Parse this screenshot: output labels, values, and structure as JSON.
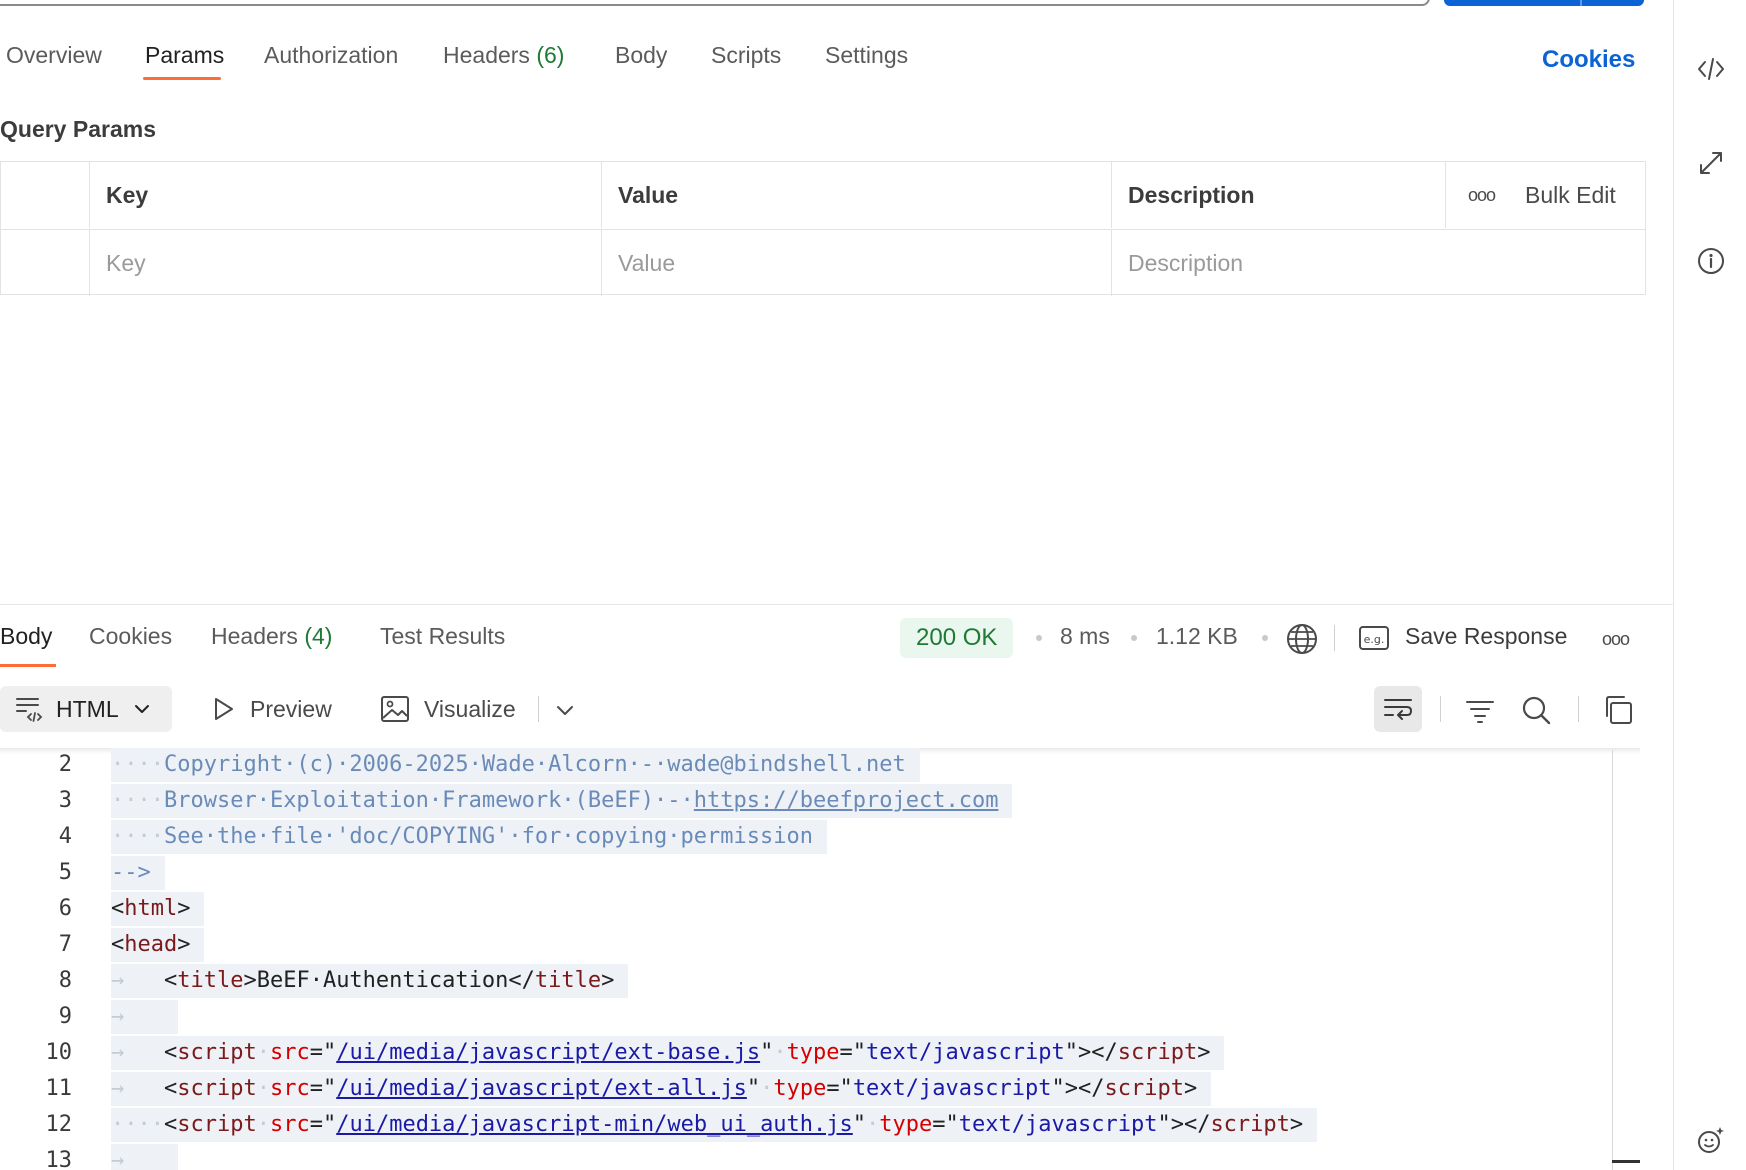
{
  "request_tabs": [
    {
      "label": "Overview"
    },
    {
      "label": "Params"
    },
    {
      "label": "Authorization"
    },
    {
      "label": "Headers",
      "count": "(6)"
    },
    {
      "label": "Body"
    },
    {
      "label": "Scripts"
    },
    {
      "label": "Settings"
    }
  ],
  "cookies_link": "Cookies",
  "query_params": {
    "title": "Query Params",
    "columns": [
      "Key",
      "Value",
      "Description"
    ],
    "bulk_edit": "Bulk Edit",
    "more": "ooo",
    "placeholders": {
      "key": "Key",
      "value": "Value",
      "description": "Description"
    }
  },
  "response": {
    "tabs": [
      {
        "label": "Body"
      },
      {
        "label": "Cookies"
      },
      {
        "label": "Headers",
        "count": "(4)"
      },
      {
        "label": "Test Results"
      }
    ],
    "status": "200 OK",
    "time": "8 ms",
    "size": "1.12 KB",
    "save_response": "Save Response",
    "more": "ooo",
    "format": "HTML",
    "preview": "Preview",
    "visualize": "Visualize"
  },
  "code_lines": [
    {
      "n": "2"
    },
    {
      "n": "3"
    },
    {
      "n": "4"
    },
    {
      "n": "5"
    },
    {
      "n": "6"
    },
    {
      "n": "7"
    },
    {
      "n": "8"
    },
    {
      "n": "9"
    },
    {
      "n": "10"
    },
    {
      "n": "11"
    },
    {
      "n": "12"
    },
    {
      "n": "13"
    }
  ],
  "code_text": {
    "l2": "Copyright·(c)·2006-2025·Wade·Alcorn·-·wade@bindshell.net",
    "l3a": "Browser·Exploitation·Framework·(BeEF)·-·",
    "l3b": "https://beefproject.com",
    "l4": "See·the·file·'doc/COPYING'·for·copying·permission",
    "l5": "-->",
    "l6": "html",
    "l7": "head",
    "l8_tag": "title",
    "l8_text": "BeEF·Authentication",
    "l10_src": "/ui/media/javascript/ext-base.js",
    "l11_src": "/ui/media/javascript/ext-all.js",
    "l12_src": "/ui/media/javascript-min/web_ui_auth.js",
    "script": "script",
    "src": "src",
    "type": "type",
    "type_val": "text/javascript"
  },
  "colors": {
    "accent": "#ff6c37",
    "link": "#0b63d6",
    "success": "#1e7a35"
  }
}
